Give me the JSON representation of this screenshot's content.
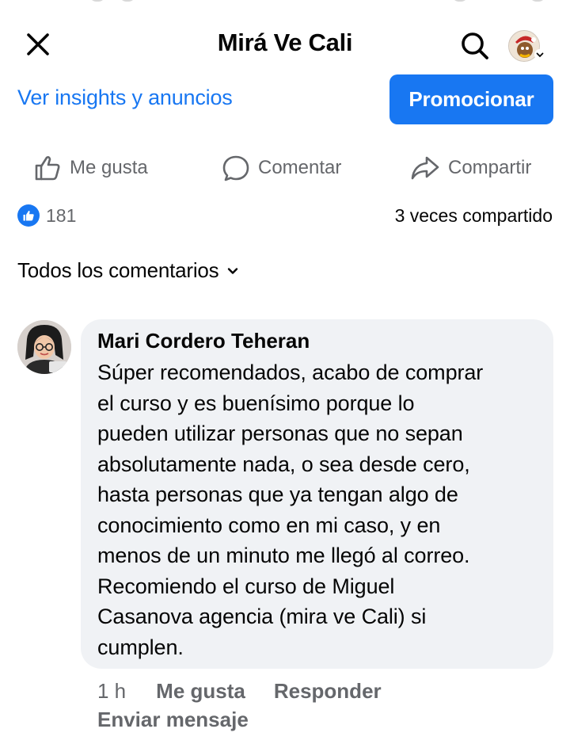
{
  "header": {
    "title": "Mirá Ve Cali",
    "close_icon": "close-icon",
    "search_icon": "search-icon",
    "profile_icon": "profile-avatar-switcher"
  },
  "admin_bar": {
    "insights_link": "Ver insights y anuncios",
    "promote_button": "Promocionar"
  },
  "actions": {
    "like_label": "Me gusta",
    "comment_label": "Comentar",
    "share_label": "Compartir"
  },
  "stats": {
    "reactions_count": "181",
    "shares_text": "3 veces compartido"
  },
  "comments": {
    "filter_label": "Todos los comentarios",
    "items": [
      {
        "author": "Mari Cordero Teheran",
        "text": "Súper recomendados, acabo de comprar\nel curso y es buenísimo porque lo\npueden utilizar personas que no sepan\nabsolutamente nada, o sea desde cero,\nhasta personas que ya tengan algo de\nconocimiento como en mi caso, y en\nmenos de un minuto me llegó al correo.\nRecomiendo el curso de Miguel\nCasanova  agencia (mira ve Cali) si\ncumplen.",
        "time": "1 h",
        "like_label": "Me gusta",
        "reply_label": "Responder",
        "message_label": "Enviar mensaje"
      }
    ]
  },
  "colors": {
    "accent": "#1877f2",
    "secondary_text": "#65676b",
    "bubble_bg": "#f0f2f5"
  }
}
